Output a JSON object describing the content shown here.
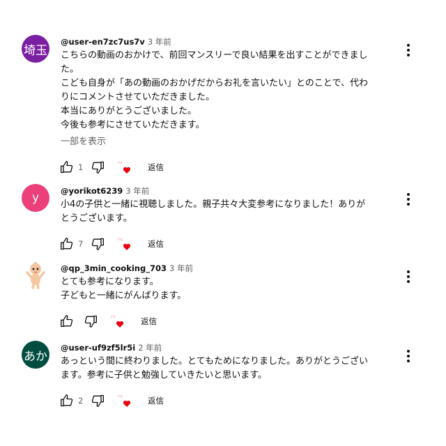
{
  "comments": [
    {
      "author": "@user-en7zc7us7v",
      "time": "3 年前",
      "avatar_text": "埼玉",
      "avatar_color": "#7b1fa2",
      "lines": [
        "こちらの動画のおかけで、前回マンスリーで良い結果を出すことができまし",
        "た。",
        "こども自身が「あの動画のおかげだからお礼を言いたい」とのことで、代わ",
        "りにコメントさせていただきました。",
        "本当にありがとうございました。",
        "今後も参考にさせていただきます。"
      ],
      "read_more": "一部を表示",
      "like_count": "1",
      "reply_label": "返信"
    },
    {
      "author": "@yorikot6239",
      "time": "3 年前",
      "avatar_text": "y",
      "avatar_color": "#ec407a",
      "lines": [
        "小4の子供と一緒に視聴しました。親子共々大変参考になりました！ありが",
        "とうございます。"
      ],
      "like_count": "7",
      "reply_label": "返信"
    },
    {
      "author": "@qp_3min_cooking_703",
      "time": "3 年前",
      "avatar_icon": "kewpie-doll-icon",
      "lines": [
        "とても参考になります。",
        "子どもと一緒にがんばります。"
      ],
      "like_count": "",
      "reply_label": "返信"
    },
    {
      "author": "@user-uf9zf5lr5i",
      "time": "2 年前",
      "avatar_text": "あか",
      "avatar_color": "#004d40",
      "lines": [
        "あっという間に終わりました。とてもためになりました。ありがとうござい",
        "ます。参考に子供と勉強していきたいと思います。"
      ],
      "like_count": "2",
      "reply_label": "返信"
    }
  ]
}
